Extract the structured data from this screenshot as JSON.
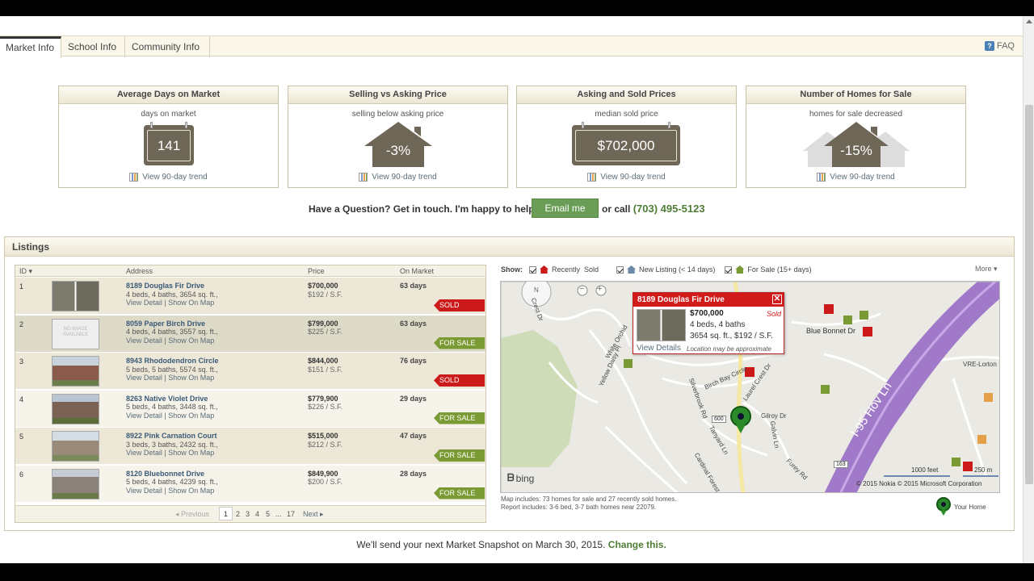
{
  "tabs": [
    {
      "label": "Market Info",
      "active": true
    },
    {
      "label": "School Info",
      "active": false
    },
    {
      "label": "Community Info",
      "active": false
    }
  ],
  "faq_label": "FAQ",
  "cards": [
    {
      "title": "Average Days on Market",
      "subtitle": "days on market",
      "value": "141",
      "trend": "View 90-day trend"
    },
    {
      "title": "Selling vs Asking Price",
      "subtitle": "selling below asking price",
      "value": "-3%",
      "trend": "View 90-day trend"
    },
    {
      "title": "Asking and Sold Prices",
      "subtitle": "median sold price",
      "value": "$702,000",
      "trend": "View 90-day trend"
    },
    {
      "title": "Number of Homes for Sale",
      "subtitle": "homes for sale decreased",
      "value": "-15%",
      "trend": "View 90-day trend"
    }
  ],
  "contact": {
    "question": "Have a Question? Get in touch. I'm happy to help.",
    "email_button": "Email me",
    "or_call": "or call",
    "phone": "(703) 495-5123"
  },
  "listings": {
    "title": "Listings",
    "columns": {
      "id": "ID",
      "address": "Address",
      "price": "Price",
      "on_market": "On Market"
    },
    "rows": [
      {
        "id": "1",
        "address": "8189 Douglas Fir Drive",
        "details": "4 beds, 4 baths, 3654 sq. ft.,",
        "price": "$700,000",
        "per_sf": "$192 / S.F.",
        "days": "63 days",
        "status": "SOLD"
      },
      {
        "id": "2",
        "address": "8059 Paper Birch Drive",
        "details": "4 beds, 4 baths, 3557 sq. ft.,",
        "price": "$799,000",
        "per_sf": "$225 / S.F.",
        "days": "63 days",
        "status": "FOR SALE",
        "no_image_text": "NO IMAGE AVAILABLE"
      },
      {
        "id": "3",
        "address": "8943 Rhododendron Circle",
        "details": "5 beds, 5 baths, 5574 sq. ft.,",
        "price": "$844,000",
        "per_sf": "$151 / S.F.",
        "days": "76 days",
        "status": "SOLD"
      },
      {
        "id": "4",
        "address": "8263 Native Violet Drive",
        "details": "5 beds, 4 baths, 3448 sq. ft.,",
        "price": "$779,900",
        "per_sf": "$226 / S.F.",
        "days": "29 days",
        "status": "FOR SALE"
      },
      {
        "id": "5",
        "address": "8922 Pink Carnation Court",
        "details": "3 beds, 3 baths, 2432 sq. ft.,",
        "price": "$515,000",
        "per_sf": "$212 / S.F.",
        "days": "47 days",
        "status": "FOR SALE"
      },
      {
        "id": "6",
        "address": "8120 Bluebonnet Drive",
        "details": "5 beds, 4 baths, 4239 sq. ft.,",
        "price": "$849,900",
        "per_sf": "$200 / S.F.",
        "days": "28 days",
        "status": "FOR SALE"
      }
    ],
    "links": {
      "view_detail": "View Detail",
      "sep": "|",
      "show_on_map": "Show On Map"
    },
    "pager": {
      "previous": "Previous",
      "pages": [
        "1",
        "2",
        "3",
        "4",
        "5",
        "...",
        "17"
      ],
      "next": "Next"
    }
  },
  "map": {
    "show_label": "Show:",
    "filters": [
      {
        "label": "Recently  Sold",
        "color": "#cc1a1a"
      },
      {
        "label": "New Listing (< 14 days)",
        "color": "#6e8aa8"
      },
      {
        "label": "For Sale (15+ days)",
        "color": "#7a9a33"
      }
    ],
    "more": "More",
    "popup": {
      "title": "8189 Douglas Fir Drive",
      "price": "$700,000",
      "status": "Sold",
      "details1": "4 beds, 4 baths",
      "details2": "3654 sq. ft., $192 / S.F.",
      "view_details": "View Details",
      "approx": "Location may be approximate"
    },
    "labels": {
      "crest_dr": "Crest Dr",
      "white_orchid": "White Orchid",
      "yellow_daisy": "Yellow Daisy Pl",
      "silverbrook": "Silverbrook Rd",
      "birch_bay": "Birch Bay Circle",
      "laurel_crest": "Laurel Crest Dr",
      "gilroy": "Gilroy Dr",
      "galvin": "Galvin Ln",
      "furey": "Furey Rd",
      "tanyard": "Tanyard Ln",
      "cardinal": "Cardinal Forest",
      "blue_bonnet": "Blue Bonnet Dr",
      "hov": "I-95 Hov Ln",
      "vre": "VRE-Lorton",
      "route600": "600",
      "route163": "163",
      "n": "N"
    },
    "brand": "bing",
    "scale_feet": "1000 feet",
    "scale_m": "250 m",
    "copyright": "© 2015 Nokia  © 2015 Microsoft Corporation",
    "note_line1": "Map includes: 73 homes for sale and 27 recently sold homes.",
    "note_line2": "Report includes: 3-6 bed, 3-7 bath homes near 22079.",
    "your_home": "Your Home"
  },
  "footer": {
    "text": "We'll send your next Market Snapshot on March 30, 2015.",
    "change": "Change this."
  },
  "colors": {
    "accent_green": "#6a9e56",
    "sold_red": "#cc1a1a",
    "for_sale_green": "#7a9a33",
    "board_brown": "#6e6656"
  }
}
